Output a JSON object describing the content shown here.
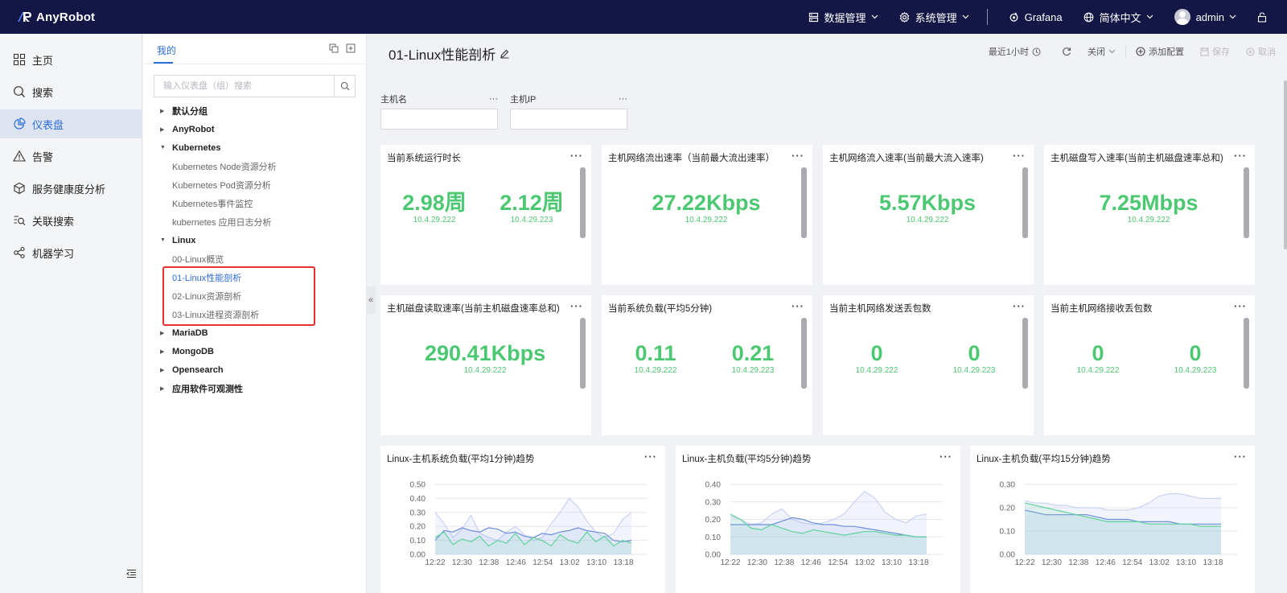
{
  "app": {
    "name": "AnyRobot"
  },
  "topbar": {
    "items": [
      {
        "label": "数据管理",
        "icon": "data-management-icon"
      },
      {
        "label": "系统管理",
        "icon": "gear-icon"
      },
      {
        "label": "Grafana",
        "icon": "grafana-icon"
      },
      {
        "label": "简体中文",
        "icon": "globe-icon"
      },
      {
        "label": "admin",
        "icon": "avatar"
      }
    ]
  },
  "leftnav": {
    "items": [
      {
        "label": "主页",
        "icon": "grid-icon"
      },
      {
        "label": "搜索",
        "icon": "search-icon"
      },
      {
        "label": "仪表盘",
        "icon": "pie-chart-icon",
        "active": true
      },
      {
        "label": "告警",
        "icon": "warning-icon"
      },
      {
        "label": "服务健康度分析",
        "icon": "cube-icon"
      },
      {
        "label": "关联搜索",
        "icon": "related-search-icon"
      },
      {
        "label": "机器学习",
        "icon": "nodes-icon"
      }
    ]
  },
  "tree": {
    "tab": "我的",
    "search_placeholder": "输入仪表盘（组）搜索",
    "nodes": [
      {
        "label": "默认分组",
        "type": "group",
        "expanded": false
      },
      {
        "label": "AnyRobot",
        "type": "group",
        "expanded": false
      },
      {
        "label": "Kubernetes",
        "type": "group",
        "expanded": true
      },
      {
        "label": "Kubernetes Node资源分析",
        "type": "leaf"
      },
      {
        "label": "Kubernetes Pod资源分析",
        "type": "leaf"
      },
      {
        "label": "Kubernetes事件监控",
        "type": "leaf"
      },
      {
        "label": "kubernetes 应用日志分析",
        "type": "leaf"
      },
      {
        "label": "Linux",
        "type": "group",
        "expanded": true
      },
      {
        "label": "00-Linux概览",
        "type": "leaf"
      },
      {
        "label": "01-Linux性能剖析",
        "type": "leaf",
        "active": true
      },
      {
        "label": "02-Linux资源剖析",
        "type": "leaf"
      },
      {
        "label": "03-Linux进程资源剖析",
        "type": "leaf"
      },
      {
        "label": "MariaDB",
        "type": "group",
        "expanded": false
      },
      {
        "label": "MongoDB",
        "type": "group",
        "expanded": false
      },
      {
        "label": "Opensearch",
        "type": "group",
        "expanded": false
      },
      {
        "label": "应用软件可观测性",
        "type": "group",
        "expanded": false
      }
    ]
  },
  "dashboard": {
    "title": "01-Linux性能剖析",
    "time_range": "最近1小时",
    "refresh": "关闭",
    "add_config": "添加配置",
    "save": "保存",
    "cancel": "取消",
    "variables": [
      {
        "label": "主机名",
        "value": ""
      },
      {
        "label": "主机IP",
        "value": ""
      }
    ],
    "more": "···"
  },
  "stat_panels": [
    {
      "title": "当前系统运行时长",
      "stats": [
        {
          "value": "2.98周",
          "ip": "10.4.29.222"
        },
        {
          "value": "2.12周",
          "ip": "10.4.29.223"
        }
      ]
    },
    {
      "title": "主机网络流出速率（当前最大流出速率）",
      "stats": [
        {
          "value": "27.22Kbps",
          "ip": "10.4.29.222"
        }
      ]
    },
    {
      "title": "主机网络流入速率(当前最大流入速率)",
      "stats": [
        {
          "value": "5.57Kbps",
          "ip": "10.4.29.222"
        }
      ]
    },
    {
      "title": "主机磁盘写入速率(当前主机磁盘速率总和)",
      "stats": [
        {
          "value": "7.25Mbps",
          "ip": "10.4.29.222"
        }
      ]
    },
    {
      "title": "主机磁盘读取速率(当前主机磁盘速率总和)",
      "stats": [
        {
          "value": "290.41Kbps",
          "ip": "10.4.29.222"
        }
      ]
    },
    {
      "title": "当前系统负载(平均5分钟)",
      "stats": [
        {
          "value": "0.11",
          "ip": "10.4.29.222"
        },
        {
          "value": "0.21",
          "ip": "10.4.29.223"
        }
      ]
    },
    {
      "title": "当前主机网络发送丢包数",
      "stats": [
        {
          "value": "0",
          "ip": "10.4.29.222"
        },
        {
          "value": "0",
          "ip": "10.4.29.223"
        }
      ]
    },
    {
      "title": "当前主机网络接收丢包数",
      "stats": [
        {
          "value": "0",
          "ip": "10.4.29.222"
        },
        {
          "value": "0",
          "ip": "10.4.29.223"
        }
      ]
    }
  ],
  "colors": {
    "topbar": "#141645",
    "accent": "#2e6ed8",
    "stat_green": "#4dc872",
    "series_blue": "#6f8fde",
    "series_green": "#5fd39a",
    "series_light": "#c8d3f5",
    "highlight": "#e62f2f"
  },
  "chart_data": [
    {
      "type": "line",
      "title": "Linux-主机系统负载(平均1分钟)趋势",
      "x": [
        "12:22",
        "12:30",
        "12:38",
        "12:46",
        "12:54",
        "13:02",
        "13:10",
        "13:18"
      ],
      "ylim": [
        0,
        0.5
      ],
      "yticks": [
        "0.00",
        "0.10",
        "0.20",
        "0.30",
        "0.40",
        "0.50"
      ],
      "series": [
        {
          "values": [
            0.3,
            0.22,
            0.12,
            0.18,
            0.28,
            0.15,
            0.12,
            0.1,
            0.16,
            0.2,
            0.14,
            0.1,
            0.12,
            0.22,
            0.3,
            0.4,
            0.34,
            0.24,
            0.16,
            0.12,
            0.15,
            0.25,
            0.3
          ]
        },
        {
          "values": [
            0.1,
            0.17,
            0.16,
            0.19,
            0.17,
            0.16,
            0.19,
            0.18,
            0.15,
            0.16,
            0.13,
            0.12,
            0.15,
            0.14,
            0.16,
            0.17,
            0.19,
            0.17,
            0.16,
            0.15,
            0.1,
            0.09,
            0.1
          ]
        },
        {
          "values": [
            0.12,
            0.16,
            0.07,
            0.11,
            0.09,
            0.13,
            0.06,
            0.1,
            0.08,
            0.15,
            0.07,
            0.12,
            0.1,
            0.06,
            0.14,
            0.1,
            0.08,
            0.16,
            0.09,
            0.13,
            0.06,
            0.1,
            0.08
          ]
        }
      ]
    },
    {
      "type": "line",
      "title": "Linux-主机负载(平均5分钟)趋势",
      "x": [
        "12:22",
        "12:30",
        "12:38",
        "12:46",
        "12:54",
        "13:02",
        "13:10",
        "13:18"
      ],
      "ylim": [
        0,
        0.4
      ],
      "yticks": [
        "0.00",
        "0.10",
        "0.20",
        "0.30",
        "0.40"
      ],
      "series": [
        {
          "values": [
            0.22,
            0.2,
            0.17,
            0.18,
            0.23,
            0.26,
            0.2,
            0.18,
            0.17,
            0.18,
            0.2,
            0.23,
            0.3,
            0.36,
            0.32,
            0.24,
            0.2,
            0.18,
            0.22,
            0.23
          ]
        },
        {
          "values": [
            0.17,
            0.17,
            0.17,
            0.17,
            0.17,
            0.19,
            0.21,
            0.2,
            0.18,
            0.17,
            0.17,
            0.16,
            0.16,
            0.15,
            0.14,
            0.13,
            0.12,
            0.11,
            0.1,
            0.1
          ]
        },
        {
          "values": [
            0.23,
            0.2,
            0.15,
            0.14,
            0.17,
            0.15,
            0.13,
            0.12,
            0.14,
            0.13,
            0.12,
            0.11,
            0.12,
            0.13,
            0.13,
            0.12,
            0.11,
            0.11,
            0.1,
            0.1
          ]
        }
      ]
    },
    {
      "type": "line",
      "title": "Linux-主机负载(平均15分钟)趋势",
      "x": [
        "12:22",
        "12:30",
        "12:38",
        "12:46",
        "12:54",
        "13:02",
        "13:10",
        "13:18"
      ],
      "ylim": [
        0,
        0.3
      ],
      "yticks": [
        "0.00",
        "0.10",
        "0.20",
        "0.30"
      ],
      "series": [
        {
          "values": [
            0.23,
            0.22,
            0.22,
            0.21,
            0.21,
            0.2,
            0.2,
            0.2,
            0.19,
            0.19,
            0.19,
            0.2,
            0.22,
            0.25,
            0.26,
            0.26,
            0.25,
            0.24,
            0.24,
            0.24
          ]
        },
        {
          "values": [
            0.19,
            0.18,
            0.17,
            0.17,
            0.17,
            0.17,
            0.17,
            0.16,
            0.15,
            0.15,
            0.15,
            0.14,
            0.14,
            0.14,
            0.14,
            0.13,
            0.13,
            0.13,
            0.13,
            0.13
          ]
        },
        {
          "values": [
            0.22,
            0.21,
            0.2,
            0.19,
            0.18,
            0.17,
            0.16,
            0.15,
            0.14,
            0.14,
            0.14,
            0.14,
            0.13,
            0.13,
            0.13,
            0.13,
            0.13,
            0.12,
            0.12,
            0.12
          ]
        }
      ]
    }
  ]
}
